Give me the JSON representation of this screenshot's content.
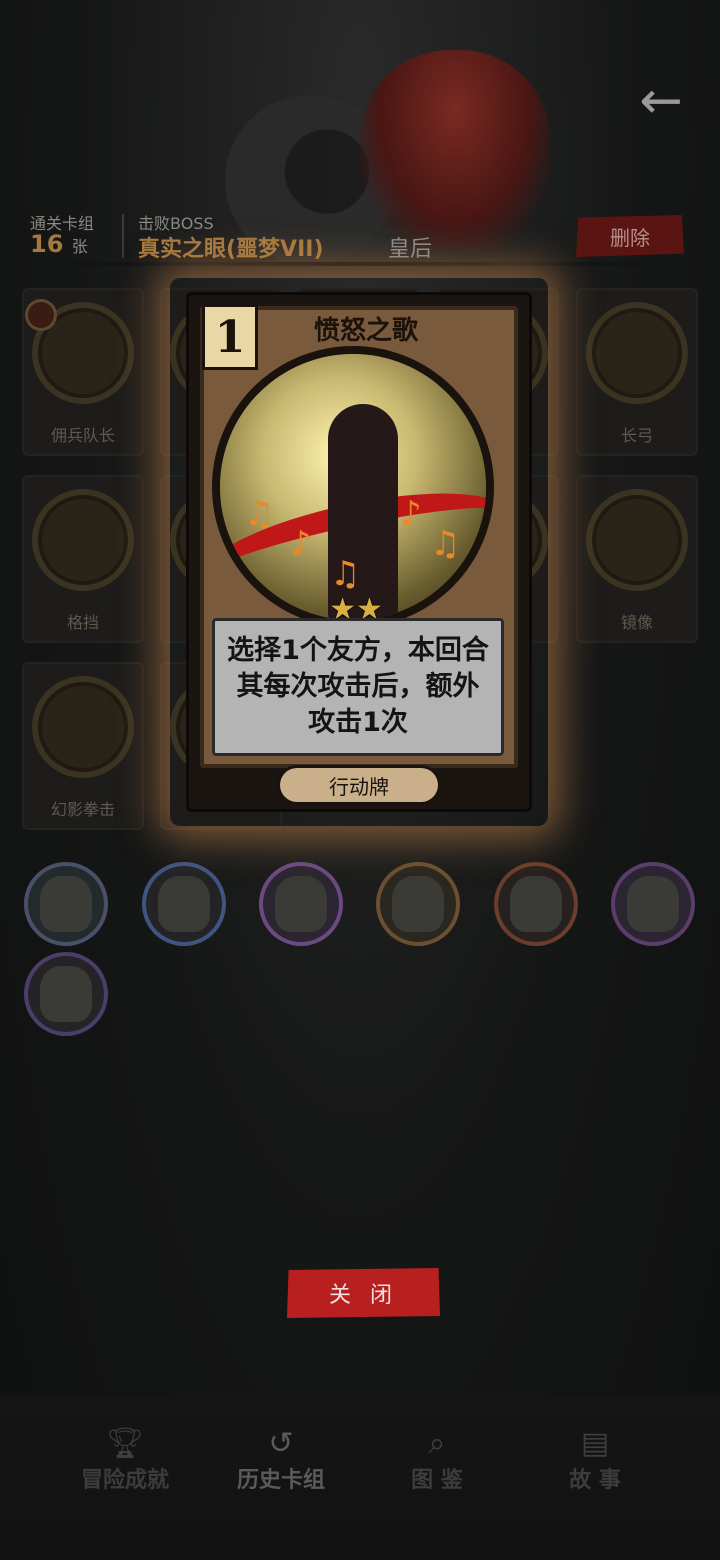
{
  "header": {
    "back_icon": "arrow-left-icon",
    "cleared_deck_label": "通关卡组",
    "card_count": "16",
    "card_unit": "张",
    "defeated_boss_label": "击败BOSS",
    "boss_name": "真实之眼(噩梦VII)",
    "boss_role": "皇后",
    "delete_label": "删除"
  },
  "grid_cards": [
    {
      "name": "佣兵队长"
    },
    {
      "name": ""
    },
    {
      "name": ""
    },
    {
      "name": ""
    },
    {
      "name": "长弓"
    },
    {
      "name": "格挡"
    },
    {
      "name": ""
    },
    {
      "name": ""
    },
    {
      "name": ""
    },
    {
      "name": "镜像"
    },
    {
      "name": "幻影拳击"
    },
    {
      "name": ""
    }
  ],
  "card_detail": {
    "cost": "1",
    "title": "愤怒之歌",
    "stars": "★★",
    "description": "选择1个友方，本回合\n其每次攻击后，额外\n攻击1次",
    "type": "行动牌"
  },
  "close_label": "关 闭",
  "nav": [
    {
      "label": "冒险成就",
      "icon": "trophy-icon"
    },
    {
      "label": "历史卡组",
      "icon": "history-icon"
    },
    {
      "label": "图 鉴",
      "icon": "magnifier-icon"
    },
    {
      "label": "故 事",
      "icon": "book-icon"
    }
  ]
}
